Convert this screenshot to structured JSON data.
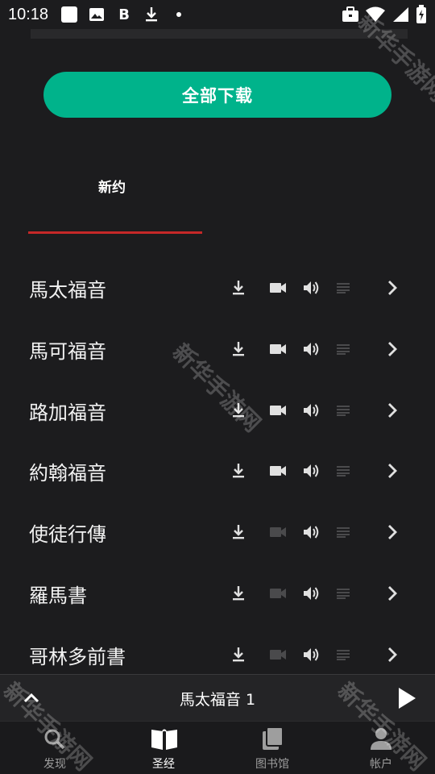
{
  "status_bar": {
    "time": "10:18",
    "icons": [
      "app-square-icon",
      "image-icon",
      "bold-b-icon",
      "download-icon",
      "dot-icon"
    ],
    "right_icons": [
      "briefcase-icon",
      "wifi-icon",
      "signal-icon",
      "battery-icon"
    ]
  },
  "actions": {
    "download_all_label": "全部下载"
  },
  "tabs": [
    {
      "label": "新约",
      "active": true
    }
  ],
  "books": [
    {
      "name": "馬太福音",
      "video": true
    },
    {
      "name": "馬可福音",
      "video": true
    },
    {
      "name": "路加福音",
      "video": true
    },
    {
      "name": "約翰福音",
      "video": true
    },
    {
      "name": "使徒行傳",
      "video": false
    },
    {
      "name": "羅馬書",
      "video": false
    },
    {
      "name": "哥林多前書",
      "video": false
    }
  ],
  "player": {
    "now_playing": "馬太福音 1"
  },
  "bottom_nav": [
    {
      "label": "发现",
      "icon": "search-icon",
      "active": false
    },
    {
      "label": "圣经",
      "icon": "book-open-icon",
      "active": true
    },
    {
      "label": "图书馆",
      "icon": "library-icon",
      "active": false
    },
    {
      "label": "帐户",
      "icon": "person-icon",
      "active": false
    }
  ],
  "watermark": {
    "text": "新华手游网"
  },
  "colors": {
    "accent": "#00b38b",
    "tab_indicator": "#c62828",
    "background": "#1c1c1e"
  }
}
